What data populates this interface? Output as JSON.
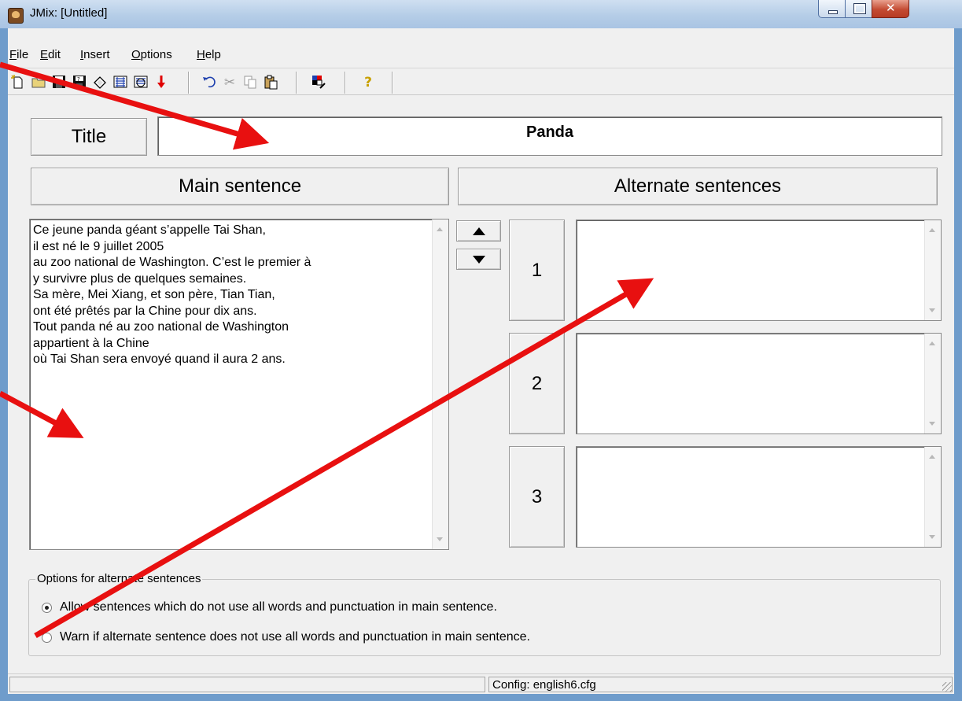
{
  "window": {
    "title": "JMix: [Untitled]"
  },
  "menu": [
    {
      "key": "F",
      "rest": "ile"
    },
    {
      "key": "E",
      "rest": "dit"
    },
    {
      "key": "I",
      "rest": "nsert"
    },
    {
      "key": "O",
      "rest": "ptions"
    },
    {
      "key": "H",
      "rest": "elp"
    }
  ],
  "toolbar": {
    "icons": [
      "new-file-icon",
      "open-folder-icon",
      "save-icon",
      "save-as-icon",
      "eraser-icon",
      "web-page-icon",
      "web-page-alt-icon",
      "down-arrow-icon",
      "undo-icon",
      "cut-icon",
      "copy-icon",
      "paste-icon",
      "palette-icon",
      "help-icon"
    ],
    "help_glyph": "?",
    "colors": {
      "help": "#c8a000",
      "arrow": "#e00000"
    }
  },
  "title_section": {
    "button_label": "Title",
    "value": "Panda"
  },
  "main_sentence": {
    "header": "Main sentence",
    "text": "Ce jeune panda géant s’appelle Tai Shan,\nil est né le 9 juillet 2005\nau zoo national de Washington. C’est le premier à\ny survivre plus de quelques semaines.\nSa mère, Mei Xiang, et son père, Tian Tian,\nont été prêtés par la Chine pour dix ans.\nTout panda né au zoo national de Washington\nappartient à la Chine\noù Tai Shan sera envoyé quand il aura 2 ans."
  },
  "alternates": {
    "header": "Alternate sentences",
    "items": [
      {
        "label": "1",
        "value": ""
      },
      {
        "label": "2",
        "value": ""
      },
      {
        "label": "3",
        "value": ""
      }
    ]
  },
  "options": {
    "legend": "Options for alternate sentences",
    "radios": [
      {
        "label": "Allow sentences which do not use all words and punctuation in main sentence.",
        "selected": true
      },
      {
        "label": "Warn if alternate sentence does not use all words and punctuation in main sentence.",
        "selected": false
      }
    ]
  },
  "statusbar": {
    "config": "Config: english6.cfg"
  },
  "annotation_color": "#e81010"
}
